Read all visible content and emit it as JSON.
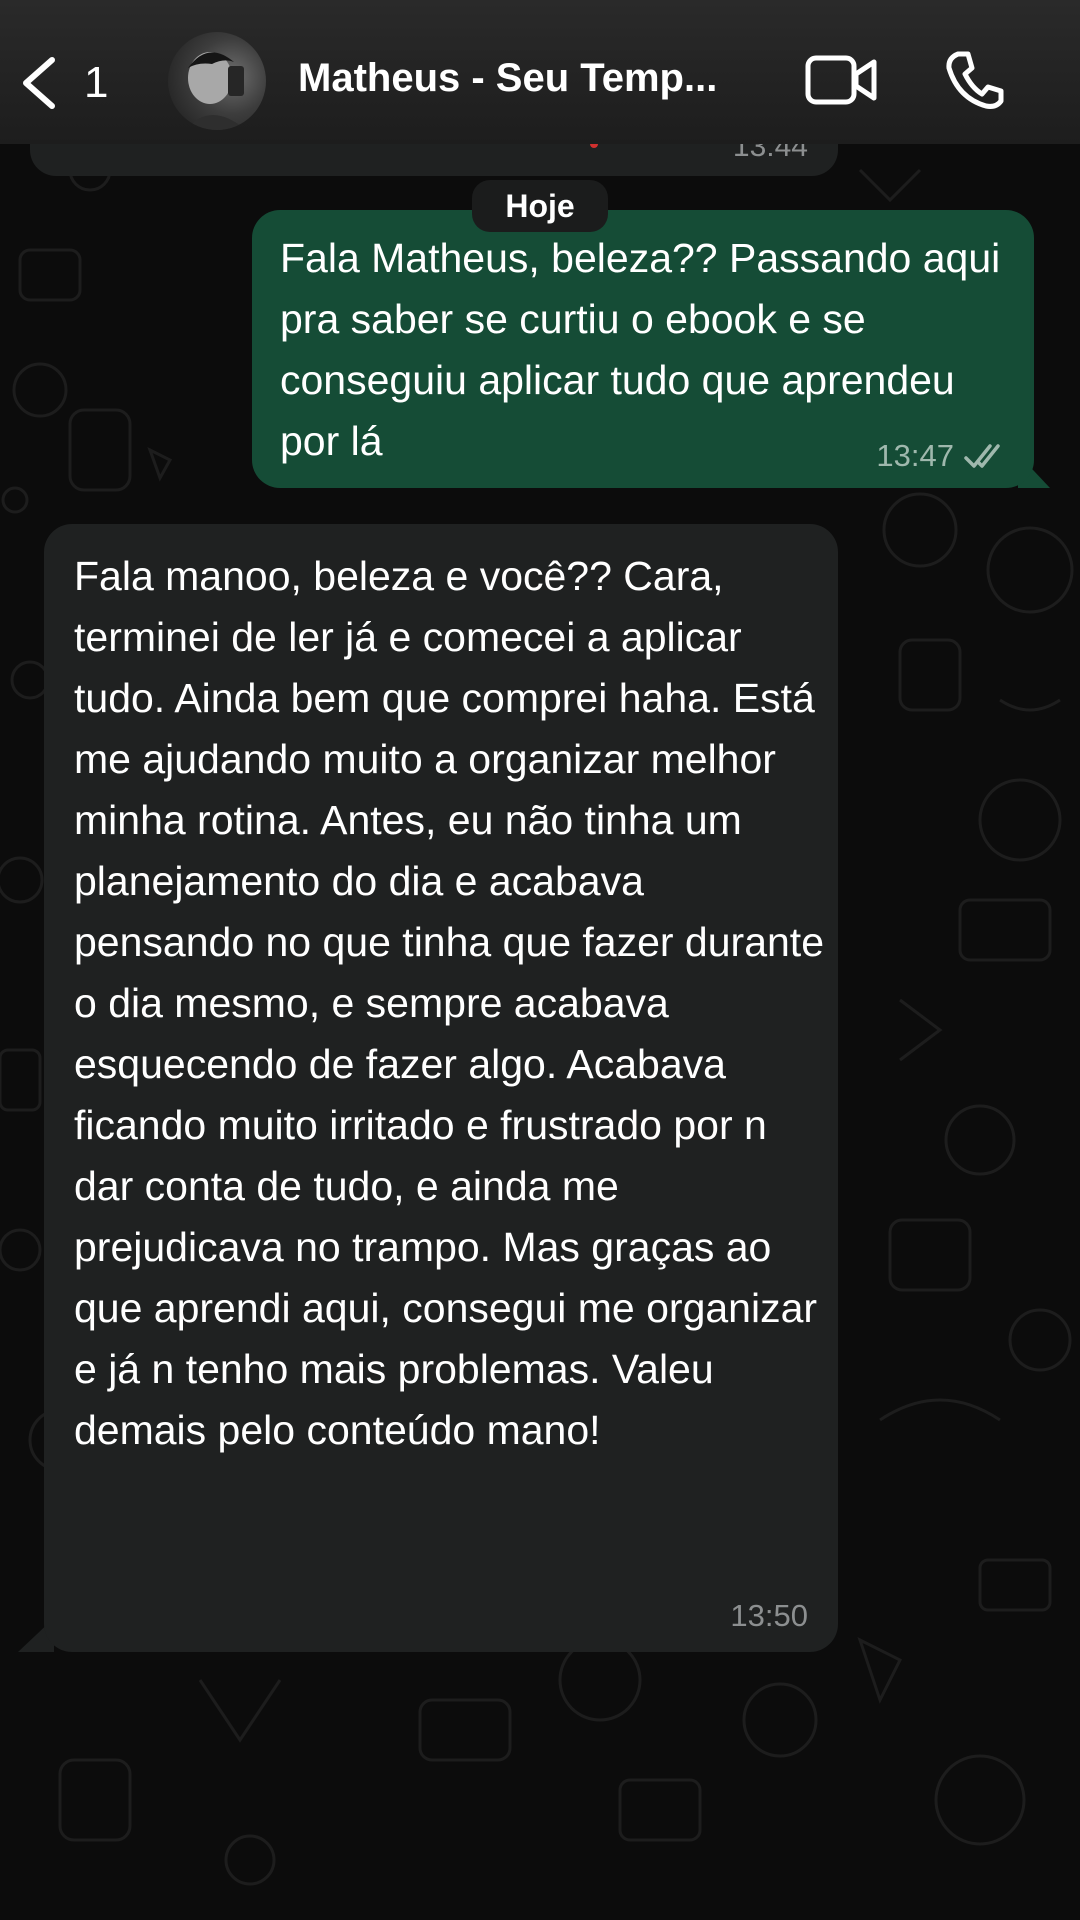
{
  "header": {
    "unread_count": "1",
    "contact_name": "Matheus - Seu Temp...",
    "back_icon": "chevron-left-icon",
    "video_icon": "video-camera-icon",
    "call_icon": "phone-icon"
  },
  "chat": {
    "previous_message_time": "13:44",
    "date_label": "Hoje",
    "messages": [
      {
        "direction": "outgoing",
        "text": "Fala Matheus, beleza?? Passando aqui pra saber se curtiu o ebook e se conseguiu aplicar tudo que aprendeu por lá",
        "time": "13:47",
        "status": "read"
      },
      {
        "direction": "incoming",
        "text": "Fala manoo, beleza e você?? Cara, terminei de ler já e comecei a aplicar tudo. Ainda bem que comprei haha. Está me ajudando muito a organizar melhor minha rotina. Antes, eu não tinha um planejamento do dia e acabava pensando no que tinha que fazer durante o dia mesmo, e sempre acabava esquecendo de fazer algo. Acabava ficando muito irritado e frustrado por n dar conta de tudo, e ainda me prejudicava no trampo. Mas graças ao que aprendi aqui, consegui me organizar e já n tenho mais problemas. Valeu demais pelo conteúdo mano!",
        "time": "13:50"
      }
    ]
  },
  "colors": {
    "outgoing_bubble": "#154c36",
    "incoming_bubble": "#1f2121",
    "background": "#0c0c0c"
  }
}
